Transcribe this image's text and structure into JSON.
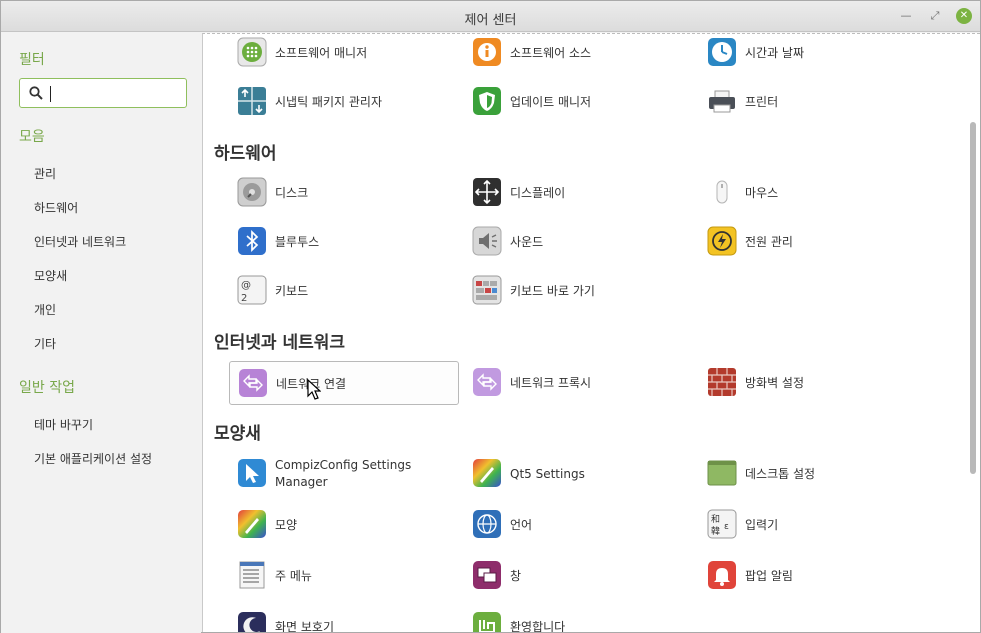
{
  "window": {
    "title": "제어 센터"
  },
  "sidebar": {
    "filter_heading": "필터",
    "search_value": "",
    "collections_heading": "모음",
    "collections": [
      "관리",
      "하드웨어",
      "인터넷과 네트워크",
      "모양새",
      "개인",
      "기타"
    ],
    "tasks_heading": "일반 작업",
    "tasks": [
      "테마 바꾸기",
      "기본 애플리케이션 설정"
    ]
  },
  "sections": {
    "admin": {
      "items": [
        {
          "label": "소프트웨어 매니저",
          "icon": "software-manager-icon"
        },
        {
          "label": "소프트웨어 소스",
          "icon": "info-icon"
        },
        {
          "label": "시간과 날짜",
          "icon": "clock-icon"
        },
        {
          "label": "시냅틱 패키지 관리자",
          "icon": "synaptic-icon"
        },
        {
          "label": "업데이트 매니저",
          "icon": "shield-icon"
        },
        {
          "label": "프린터",
          "icon": "printer-icon"
        }
      ]
    },
    "hardware": {
      "title": "하드웨어",
      "items": [
        {
          "label": "디스크",
          "icon": "disk-icon"
        },
        {
          "label": "디스플레이",
          "icon": "display-icon"
        },
        {
          "label": "마우스",
          "icon": "mouse-icon"
        },
        {
          "label": "블루투스",
          "icon": "bluetooth-icon"
        },
        {
          "label": "사운드",
          "icon": "sound-icon"
        },
        {
          "label": "전원 관리",
          "icon": "power-icon"
        },
        {
          "label": "키보드",
          "icon": "keyboard-icon"
        },
        {
          "label": "키보드 바로 가기",
          "icon": "keyboard-shortcuts-icon"
        }
      ]
    },
    "network": {
      "title": "인터넷과 네트워크",
      "items": [
        {
          "label": "네트워크 연결",
          "icon": "network-icon"
        },
        {
          "label": "네트워크 프록시",
          "icon": "proxy-icon"
        },
        {
          "label": "방화벽 설정",
          "icon": "firewall-icon"
        }
      ]
    },
    "appearance": {
      "title": "모양새",
      "items": [
        {
          "label": "CompizConfig Settings Manager",
          "icon": "compiz-icon"
        },
        {
          "label": "Qt5 Settings",
          "icon": "qt5-icon"
        },
        {
          "label": "데스크톱 설정",
          "icon": "desktop-icon"
        },
        {
          "label": "모양",
          "icon": "themes-icon"
        },
        {
          "label": "언어",
          "icon": "language-icon"
        },
        {
          "label": "입력기",
          "icon": "input-method-icon"
        },
        {
          "label": "주 메뉴",
          "icon": "menu-icon"
        },
        {
          "label": "창",
          "icon": "windows-icon"
        },
        {
          "label": "팝업 알림",
          "icon": "bell-icon"
        },
        {
          "label": "화면 보호기",
          "icon": "screensaver-icon"
        },
        {
          "label": "환영합니다",
          "icon": "welcome-icon"
        }
      ]
    }
  },
  "colors": {
    "accent": "#79a84b",
    "search_border": "#8fbf5d"
  }
}
